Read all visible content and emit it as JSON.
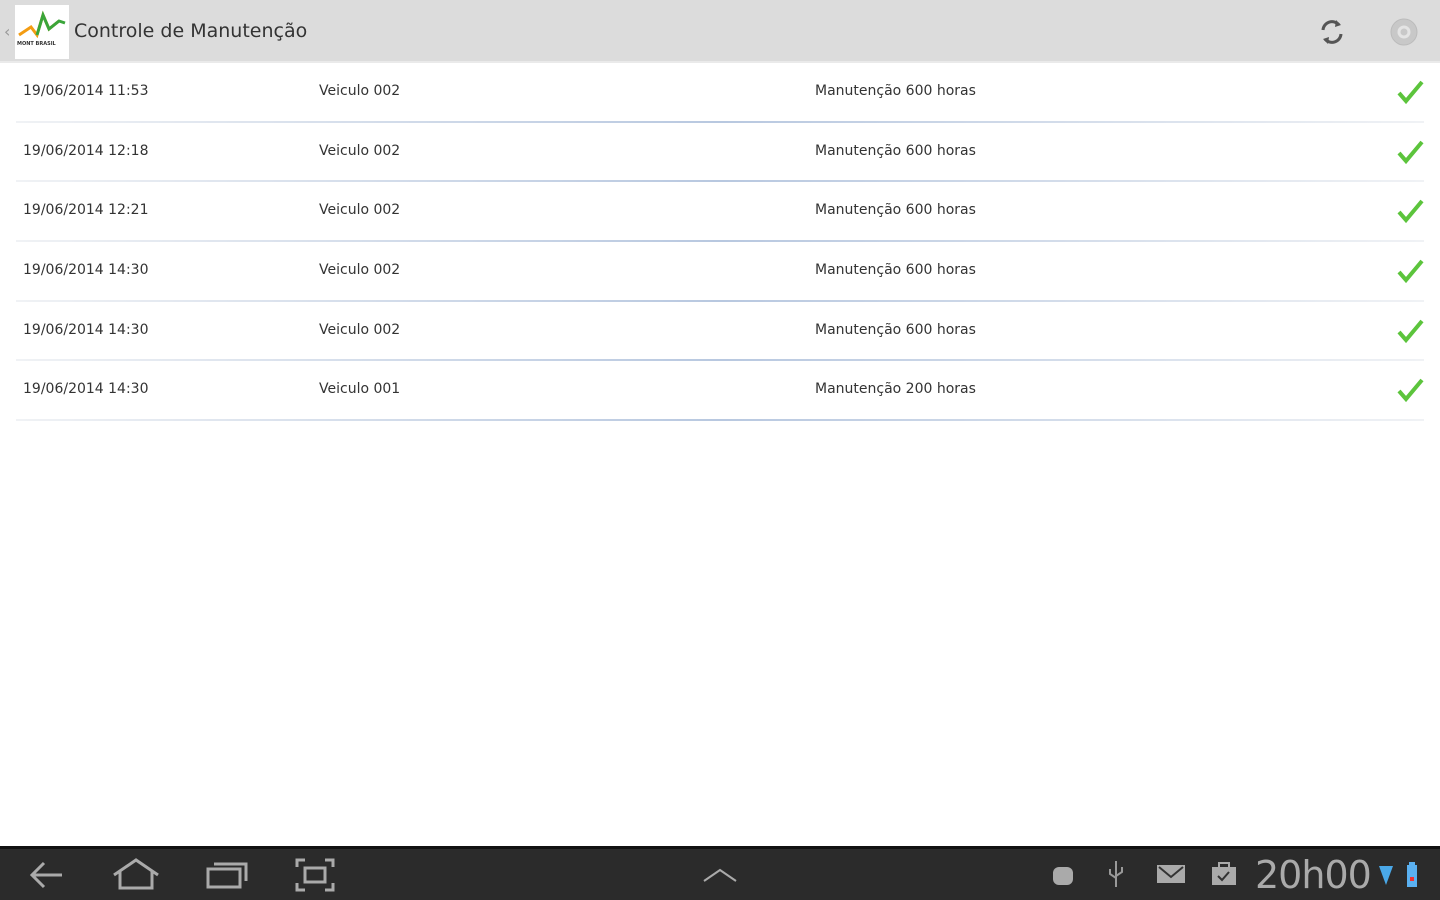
{
  "header": {
    "title": "Controle de Manutenção",
    "logo_text": "MONT BRASIL",
    "icons": [
      "back-chevron-icon",
      "refresh-icon",
      "settings-icon"
    ]
  },
  "rows": [
    {
      "date": "19/06/2014 11:53",
      "vehicle": "Veiculo 002",
      "service": "Manutenção 600 horas",
      "status": "check-icon"
    },
    {
      "date": "19/06/2014 12:18",
      "vehicle": "Veiculo 002",
      "service": "Manutenção 600 horas",
      "status": "check-icon"
    },
    {
      "date": "19/06/2014 12:21",
      "vehicle": "Veiculo 002",
      "service": "Manutenção 600 horas",
      "status": "check-icon"
    },
    {
      "date": "19/06/2014 14:30",
      "vehicle": "Veiculo 002",
      "service": "Manutenção 600 horas",
      "status": "check-icon"
    },
    {
      "date": "19/06/2014 14:30",
      "vehicle": "Veiculo 002",
      "service": "Manutenção 600 horas",
      "status": "check-icon"
    },
    {
      "date": "19/06/2014 14:30",
      "vehicle": "Veiculo 001",
      "service": "Manutenção 200 horas",
      "status": "check-icon"
    }
  ],
  "statusbar": {
    "time": "20h00"
  },
  "colors": {
    "accent": "#5cc43c",
    "actionbar": "#dcdcdc",
    "navbar": "#2b2b2b"
  }
}
